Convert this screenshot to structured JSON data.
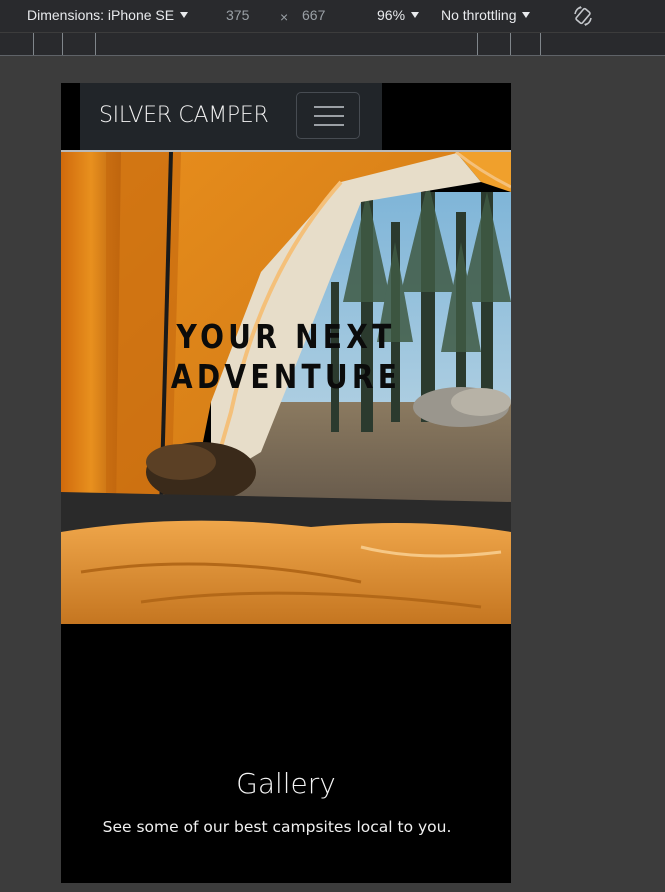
{
  "devtools": {
    "dimensions_label": "Dimensions: iPhone SE",
    "width": "375",
    "times": "×",
    "height": "667",
    "zoom": "96%",
    "throttle": "No throttling",
    "rotate_icon": "rotate-icon"
  },
  "site": {
    "brand": "SILVER CAMPER",
    "menu_icon": "hamburger-icon",
    "hero_title": "YOUR NEXT\nADVENTURE",
    "gallery_title": "Gallery",
    "gallery_subtitle": "See some of our best campsites local to you."
  },
  "colors": {
    "navbar_bg": "#212529",
    "page_bg": "#000000",
    "tent_orange": "#e08a1c"
  }
}
